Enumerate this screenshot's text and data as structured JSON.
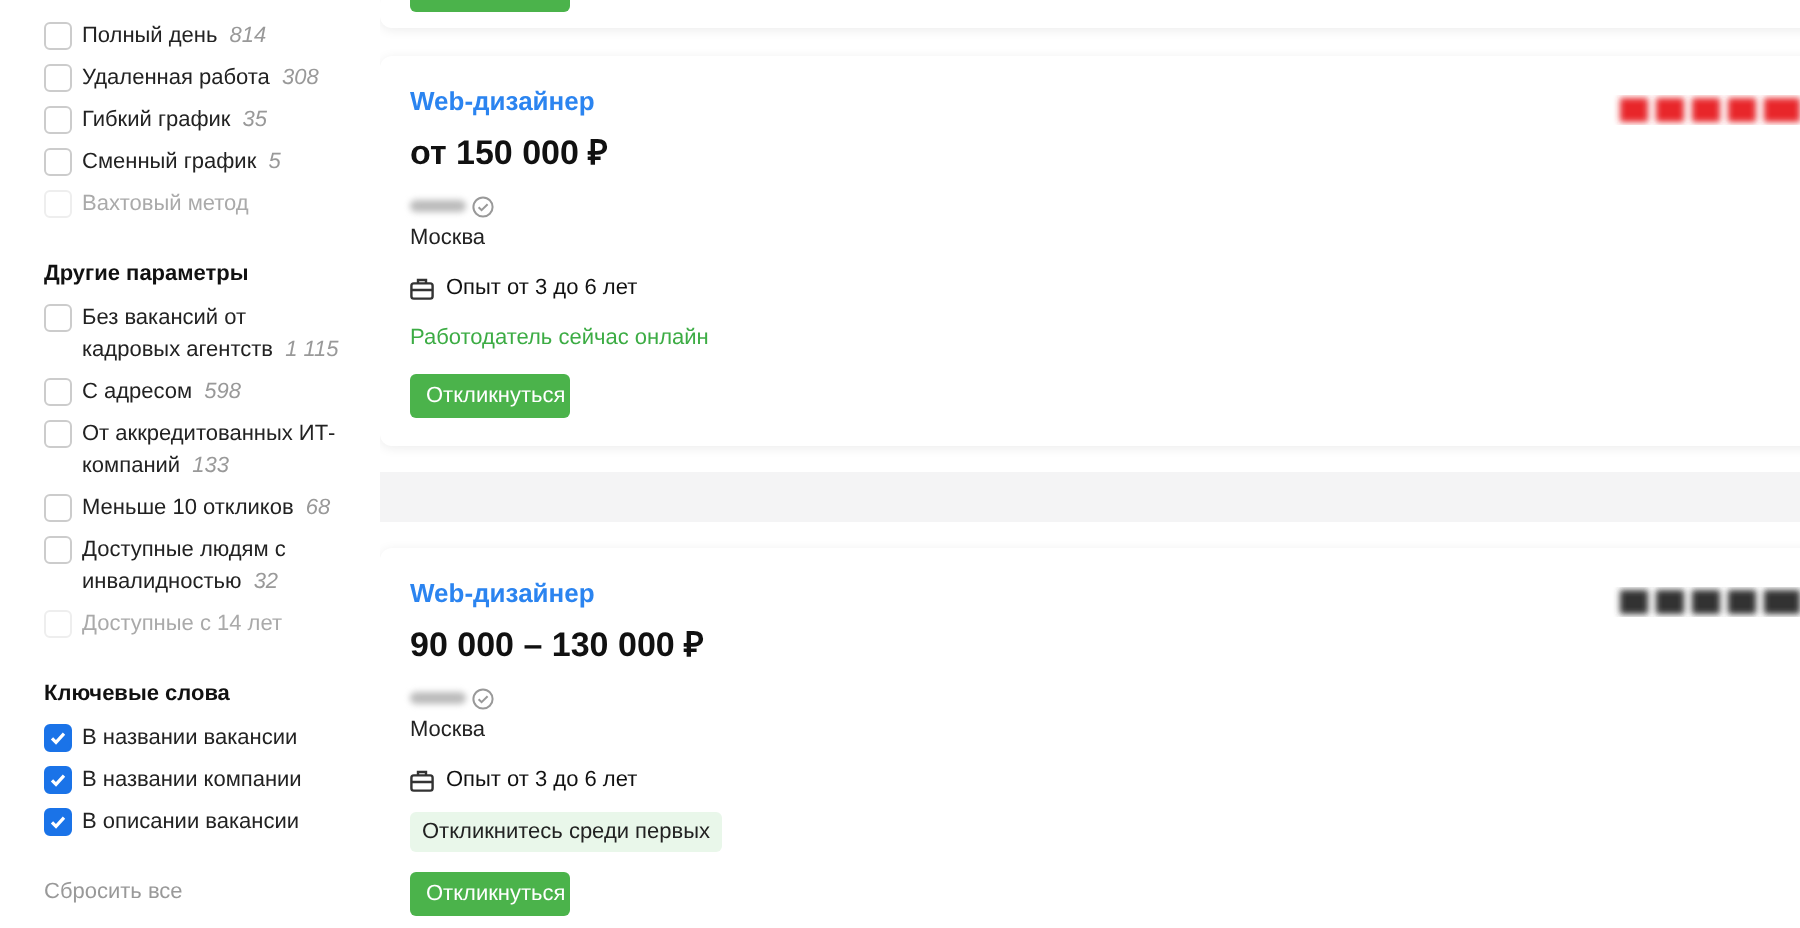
{
  "filters": {
    "groups": [
      {
        "items": [
          {
            "label": "Полный день",
            "count": "814",
            "checked": false,
            "disabled": false
          },
          {
            "label": "Удаленная работа",
            "count": "308",
            "checked": false,
            "disabled": false
          },
          {
            "label": "Гибкий график",
            "count": "35",
            "checked": false,
            "disabled": false
          },
          {
            "label": "Сменный график",
            "count": "5",
            "checked": false,
            "disabled": false
          },
          {
            "label": "Вахтовый метод",
            "checked": false,
            "disabled": true
          }
        ]
      },
      {
        "title": "Другие параметры",
        "items": [
          {
            "label": "Без вакансий от кадровых агентств",
            "count": "1 115",
            "checked": false,
            "disabled": false
          },
          {
            "label": "С адресом",
            "count": "598",
            "checked": false,
            "disabled": false
          },
          {
            "label": "От аккредитованных ИТ-компаний",
            "count": "133",
            "checked": false,
            "disabled": false
          },
          {
            "label": "Меньше 10 откликов",
            "count": "68",
            "checked": false,
            "disabled": false
          },
          {
            "label": "Доступные людям с инвалидностью",
            "count": "32",
            "checked": false,
            "disabled": false
          },
          {
            "label": "Доступные с 14 лет",
            "checked": false,
            "disabled": true
          }
        ]
      },
      {
        "title": "Ключевые слова",
        "items": [
          {
            "label": "В названии вакансии",
            "checked": true,
            "disabled": false
          },
          {
            "label": "В названии компании",
            "checked": true,
            "disabled": false
          },
          {
            "label": "В описании вакансии",
            "checked": true,
            "disabled": false
          }
        ]
      }
    ],
    "reset": "Сбросить все"
  },
  "vacancies": [
    {
      "title": "Web-дизайнер",
      "salary": "от 150 000 ₽",
      "city": "Москва",
      "experience": "Опыт от 3 до 6 лет",
      "badge": {
        "kind": "online",
        "text": "Работодатель сейчас онлайн"
      },
      "button": "Откликнуться",
      "color": "#e8262c"
    },
    {
      "title": "Web-дизайнер",
      "salary": "90 000 – 130 000 ₽",
      "city": "Москва",
      "experience": "Опыт от 3 до 6 лет",
      "badge": {
        "kind": "hint",
        "text": "Откликнитесь среди первых"
      },
      "button": "Откликнуться",
      "color": "#333333"
    }
  ]
}
